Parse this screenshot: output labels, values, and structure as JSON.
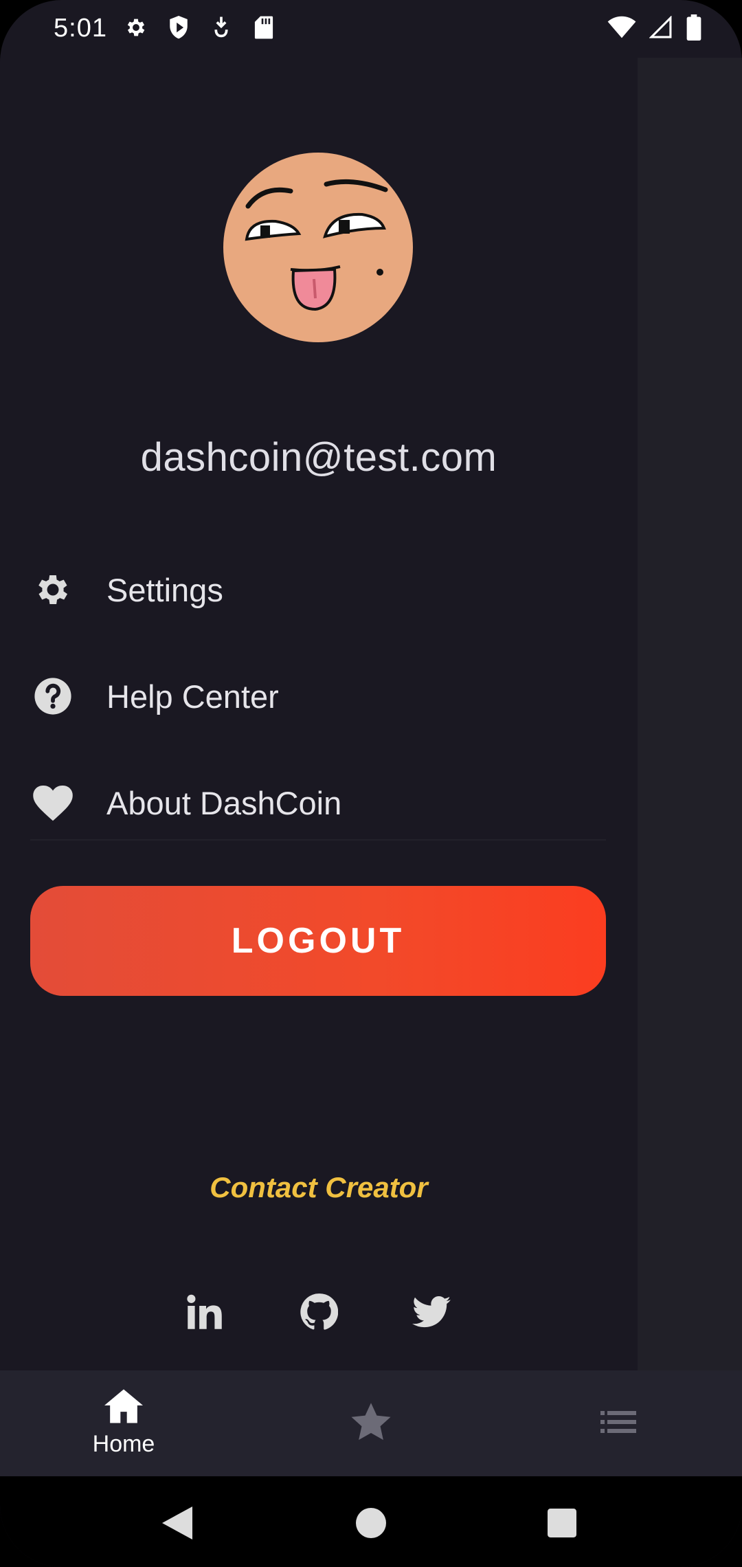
{
  "status_bar": {
    "time": "5:01",
    "left_icons": [
      "gear-icon",
      "shield-play-icon",
      "download-icon",
      "sd-card-icon"
    ],
    "right_icons": [
      "wifi-icon",
      "cell-signal-icon",
      "battery-icon"
    ]
  },
  "drawer": {
    "avatar": "emoji-face-avatar",
    "email": "dashcoin@test.com",
    "menu": [
      {
        "label": "Settings",
        "icon": "gear-icon"
      },
      {
        "label": "Help Center",
        "icon": "help-circle-icon"
      },
      {
        "label": "About DashCoin",
        "icon": "heart-icon"
      }
    ],
    "logout_label": "LOGOUT",
    "contact_label": "Contact Creator",
    "social": [
      "linkedin-icon",
      "github-icon",
      "twitter-icon"
    ]
  },
  "bottom_nav": {
    "items": [
      {
        "label": "Home",
        "icon": "home-icon",
        "active": true
      },
      {
        "label": "",
        "icon": "star-icon",
        "active": false
      },
      {
        "label": "",
        "icon": "list-icon",
        "active": false
      }
    ]
  },
  "colors": {
    "drawer_bg": "#1a1822",
    "logout_start": "#e34c38",
    "logout_end": "#fb3d20",
    "contact": "#f0c040",
    "bottom_nav_bg": "#24232e"
  }
}
